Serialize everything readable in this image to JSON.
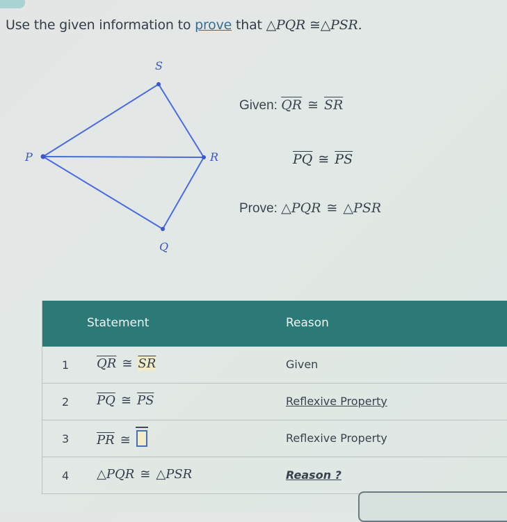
{
  "prompt": {
    "prefix": "Use the given information to ",
    "link": "prove",
    "middle": " that ",
    "statement_left": "PQR",
    "congruent": "≅",
    "statement_right": "PSR",
    "triangle": "△",
    "end": "."
  },
  "diagram": {
    "vertices": [
      "S",
      "P",
      "R",
      "Q"
    ],
    "line_color": "#4a6be0",
    "label_color": "#3d56c7"
  },
  "given": {
    "label": "Given:",
    "items": [
      {
        "left": "QR",
        "symbol": "≅",
        "right": "SR"
      },
      {
        "left": "PQ",
        "symbol": "≅",
        "right": "PS"
      }
    ]
  },
  "prove": {
    "label": "Prove:",
    "triangle": "△",
    "left": "PQR",
    "symbol": "≅",
    "right": "PSR"
  },
  "table": {
    "header_color": "#2c7a78",
    "headers": {
      "statement": "Statement",
      "reason": "Reason"
    },
    "rows": [
      {
        "num": "1",
        "left": "QR",
        "symbol": "≅",
        "right": "SR",
        "reason": "Given"
      },
      {
        "num": "2",
        "left": "PQ",
        "symbol": "≅",
        "right": "PS",
        "reason": "Reflexive Property"
      },
      {
        "num": "3",
        "left": "PR",
        "symbol": "≅",
        "right": "",
        "reason": "Reflexive Property"
      },
      {
        "num": "4",
        "triangle": "△",
        "left": "PQR",
        "symbol": "≅",
        "right": "PSR",
        "reason": "Reason ?"
      }
    ]
  }
}
